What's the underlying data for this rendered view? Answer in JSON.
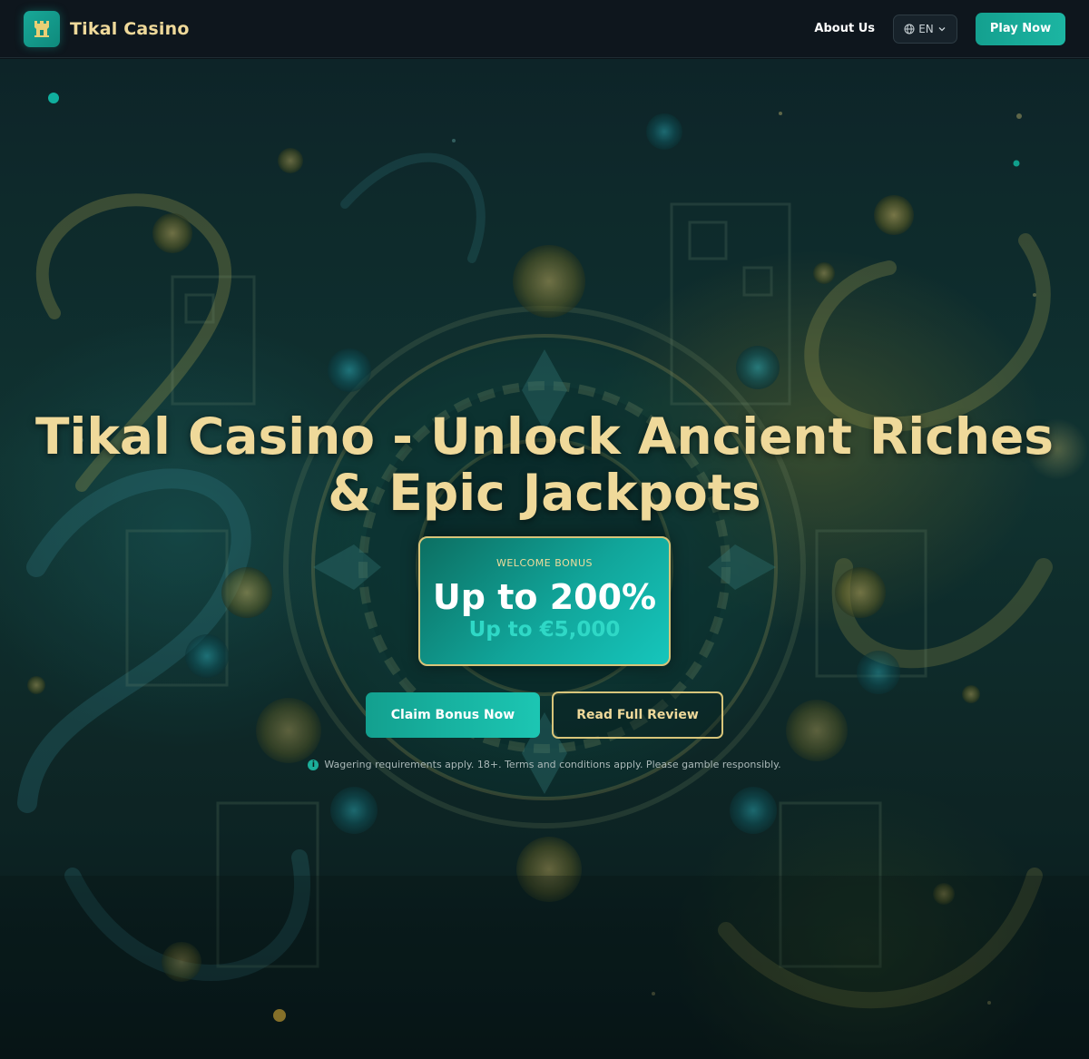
{
  "header": {
    "brand_name": "Tikal Casino",
    "about_label": "About Us",
    "language": "EN",
    "play_label": "Play Now"
  },
  "hero": {
    "title": "Tikal Casino - Unlock Ancient Riches & Epic Jackpots",
    "bonus": {
      "label": "WELCOME BONUS",
      "main": "Up to 200%",
      "sub": "Up to €5,000"
    },
    "claim_label": "Claim Bonus Now",
    "review_label": "Read Full Review",
    "disclaimer": "Wagering requirements apply. 18+. Terms and conditions apply. Please gamble responsibly."
  },
  "colors": {
    "accent_teal": "#1cb5a2",
    "gold": "#efd99a",
    "header_bg": "#0e161d"
  },
  "icons": {
    "logo": "castle-tower-icon",
    "language": "globe-icon",
    "dropdown": "chevron-down-icon",
    "info": "info-icon"
  }
}
